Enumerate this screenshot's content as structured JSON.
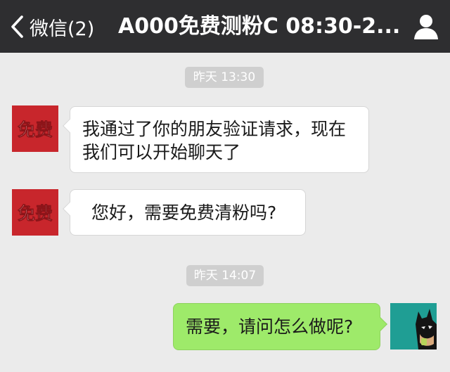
{
  "header": {
    "back_label": "微信(2)",
    "title": "A000免费测粉C 08:30-2..."
  },
  "messages": [
    {
      "type": "time",
      "text": "昨天 13:30"
    },
    {
      "type": "incoming",
      "avatar_text": "免费",
      "lines": [
        "我通过了你的朋友验证请求，现在",
        "我们可以开始聊天了"
      ]
    },
    {
      "type": "incoming",
      "avatar_text": "免费",
      "lines": [
        "您好，需要免费清粉吗?"
      ]
    },
    {
      "type": "time",
      "text": "昨天 14:07"
    },
    {
      "type": "outgoing",
      "lines": [
        "需要，请问怎么做呢?"
      ]
    }
  ],
  "colors": {
    "navbar": "#2e2e30",
    "chat_background": "#ebebeb",
    "incoming_bubble": "#ffffff",
    "outgoing_bubble": "#9eea6a",
    "avatar_red": "#c8262c"
  },
  "icons": {
    "back": "chevron-left-icon",
    "contact": "person-icon"
  }
}
